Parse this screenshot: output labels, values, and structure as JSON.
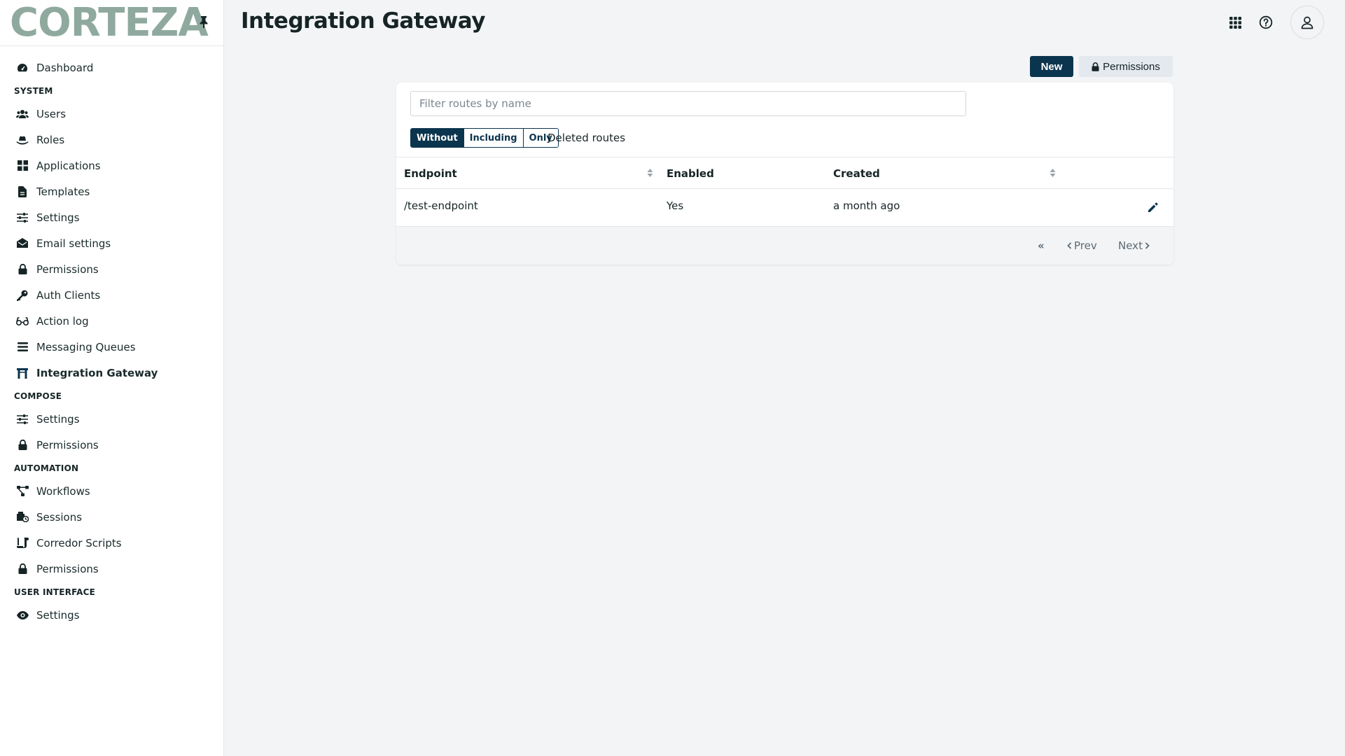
{
  "app": {
    "logo_text": "CORTEZA",
    "brand_color": "#8fa99e",
    "primary_color": "#0b344e"
  },
  "sidebar": {
    "top_items": [
      {
        "label": "Dashboard",
        "icon": "dashboard-icon"
      }
    ],
    "sections": [
      {
        "title": "SYSTEM",
        "items": [
          {
            "label": "Users",
            "icon": "users-icon"
          },
          {
            "label": "Roles",
            "icon": "hat-icon"
          },
          {
            "label": "Applications",
            "icon": "grid-icon"
          },
          {
            "label": "Templates",
            "icon": "file-icon"
          },
          {
            "label": "Settings",
            "icon": "sliders-icon"
          },
          {
            "label": "Email settings",
            "icon": "envelope-icon"
          },
          {
            "label": "Permissions",
            "icon": "lock-icon"
          },
          {
            "label": "Auth Clients",
            "icon": "key-icon"
          },
          {
            "label": "Action log",
            "icon": "glasses-icon"
          },
          {
            "label": "Messaging Queues",
            "icon": "queue-icon"
          },
          {
            "label": "Integration Gateway",
            "icon": "gateway-icon",
            "active": true
          }
        ]
      },
      {
        "title": "COMPOSE",
        "items": [
          {
            "label": "Settings",
            "icon": "sliders-icon"
          },
          {
            "label": "Permissions",
            "icon": "lock-icon"
          }
        ]
      },
      {
        "title": "AUTOMATION",
        "items": [
          {
            "label": "Workflows",
            "icon": "workflow-icon"
          },
          {
            "label": "Sessions",
            "icon": "sessions-icon"
          },
          {
            "label": "Corredor Scripts",
            "icon": "scroll-icon"
          },
          {
            "label": "Permissions",
            "icon": "lock-icon"
          }
        ]
      },
      {
        "title": "USER INTERFACE",
        "items": [
          {
            "label": "Settings",
            "icon": "eye-icon"
          }
        ]
      }
    ]
  },
  "header": {
    "title": "Integration Gateway"
  },
  "toolbar": {
    "new_label": "New",
    "permissions_label": "Permissions"
  },
  "filter": {
    "placeholder": "Filter routes by name",
    "value": ""
  },
  "deleted_filter": {
    "options": [
      "Without",
      "Including",
      "Only"
    ],
    "selected": "Without",
    "label": "Deleted routes"
  },
  "table": {
    "columns": [
      "Endpoint",
      "Enabled",
      "Created"
    ],
    "rows": [
      {
        "endpoint": "/test-endpoint",
        "enabled": "Yes",
        "created": "a month ago"
      }
    ]
  },
  "pagination": {
    "first_label": "«",
    "prev_label": "Prev",
    "next_label": "Next"
  }
}
